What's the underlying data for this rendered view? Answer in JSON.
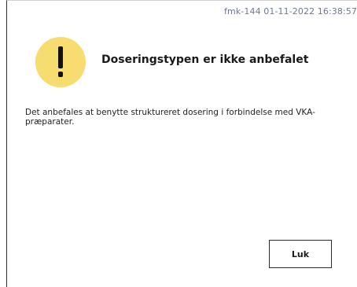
{
  "header": {
    "meta_text": "fmk-144 01-11-2022 16:38:57"
  },
  "dialog": {
    "icon": "warning-exclamation-icon",
    "icon_color": "#f7dc6f",
    "title": "Doseringstypen er ikke anbefalet",
    "message": "Det anbefales at benytte struktureret dosering i forbindelse med VKA-præparater."
  },
  "actions": {
    "close_label": "Luk"
  }
}
